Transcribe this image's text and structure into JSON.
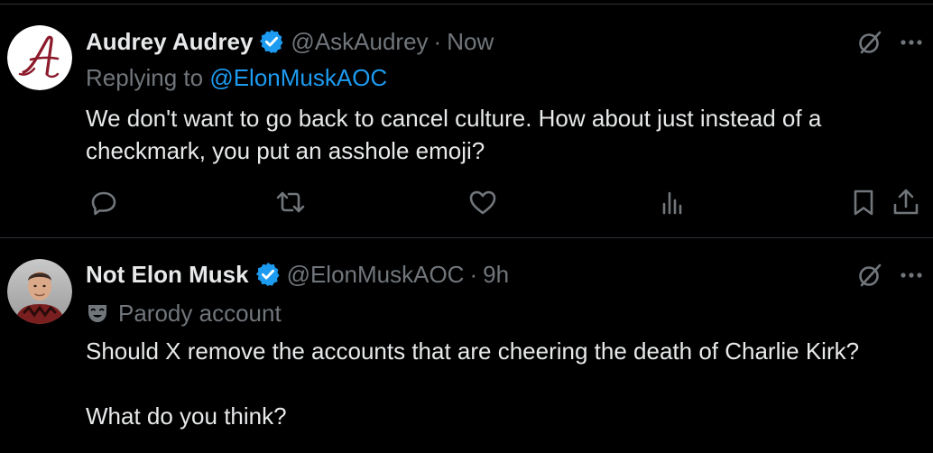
{
  "colors": {
    "background": "#000000",
    "text_primary": "#e7e9ea",
    "text_secondary": "#71767b",
    "link": "#1d9bf0",
    "verified": "#1d9bf0",
    "divider": "#2f3336"
  },
  "tweets": [
    {
      "display_name": "Audrey Audrey",
      "verified": true,
      "handle": "@AskAudrey",
      "separator": "·",
      "time": "Now",
      "replying_to_label": "Replying to",
      "replying_to_handle": "@ElonMuskAOC",
      "text": "We don't want to go back to cancel culture. How about just instead of a checkmark, you put an asshole emoji?",
      "avatar_icon": "letter-a-monogram-avatar",
      "actions": [
        "reply-icon",
        "repost-icon",
        "like-icon",
        "views-icon",
        "bookmark-icon",
        "share-icon"
      ]
    },
    {
      "display_name": "Not Elon Musk",
      "verified": true,
      "handle": "@ElonMuskAOC",
      "separator": "·",
      "time": "9h",
      "parody_label": "Parody account",
      "parody_icon": "theater-mask-icon",
      "text_lines": [
        "Should X remove the accounts that are cheering the death of Charlie Kirk?",
        "What do you think?"
      ],
      "avatar_icon": "person-photo-avatar"
    }
  ]
}
